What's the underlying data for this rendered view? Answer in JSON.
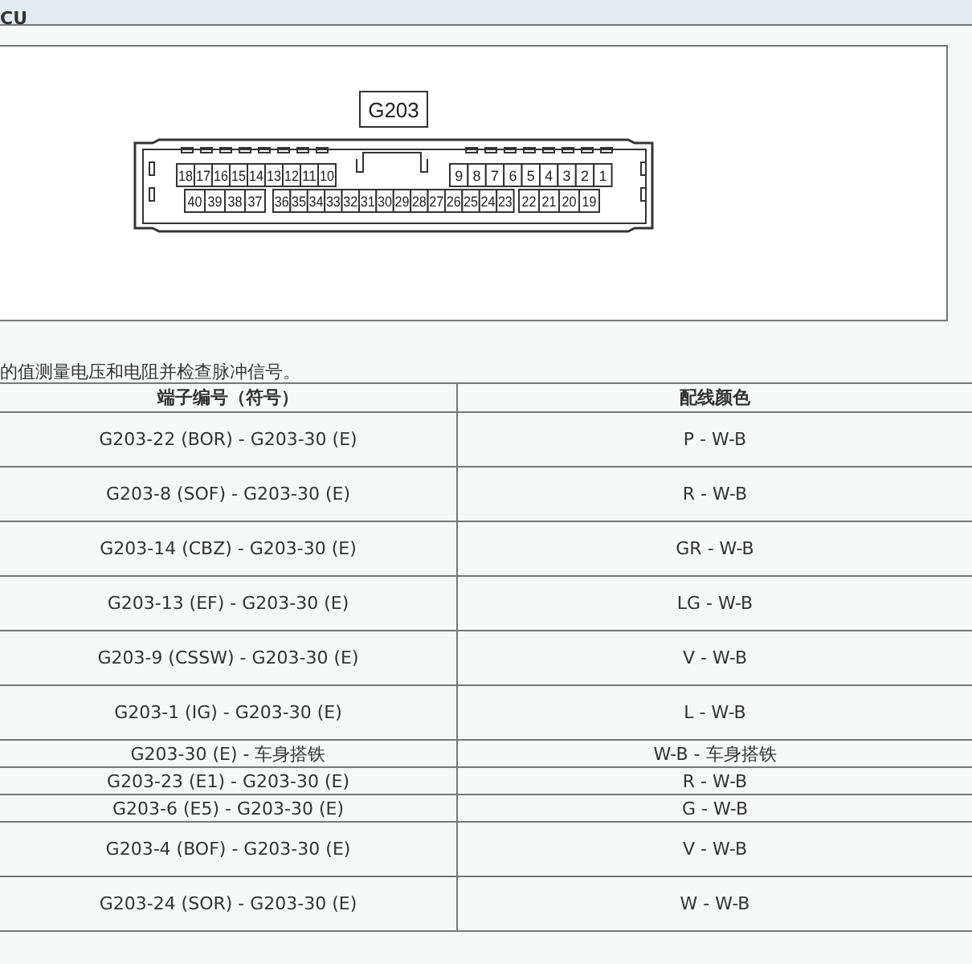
{
  "header": {
    "title": "CU"
  },
  "connector": {
    "label": "G203",
    "top_left_pins": [
      "18",
      "17",
      "16",
      "15",
      "14",
      "13",
      "12",
      "11",
      "10"
    ],
    "top_right_pins": [
      "9",
      "8",
      "7",
      "6",
      "5",
      "4",
      "3",
      "2",
      "1"
    ],
    "bottom_left_pins": [
      "40",
      "39",
      "38",
      "37"
    ],
    "bottom_middle_pins": [
      "36",
      "35",
      "34",
      "33",
      "32",
      "31",
      "30",
      "29",
      "28",
      "27",
      "26",
      "25",
      "24",
      "23"
    ],
    "bottom_right_pins": [
      "22",
      "21",
      "20",
      "19"
    ]
  },
  "instruction": "的值测量电压和电阻并检查脉冲信号。",
  "table": {
    "columns": [
      "端子编号（符号）",
      "配线颜色"
    ],
    "rows": [
      {
        "kind": "tall",
        "terminal": "G203-22 (BOR) - G203-30 (E)",
        "wire_color": "P - W-B"
      },
      {
        "kind": "tall",
        "terminal": "G203-8 (SOF) - G203-30 (E)",
        "wire_color": "R - W-B"
      },
      {
        "kind": "tall",
        "terminal": "G203-14 (CBZ) - G203-30 (E)",
        "wire_color": "GR - W-B"
      },
      {
        "kind": "tall",
        "terminal": "G203-13 (EF) - G203-30 (E)",
        "wire_color": "LG - W-B"
      },
      {
        "kind": "tall",
        "terminal": "G203-9 (CSSW) - G203-30 (E)",
        "wire_color": "V - W-B"
      },
      {
        "kind": "tall",
        "terminal": "G203-1 (IG) - G203-30 (E)",
        "wire_color": "L - W-B"
      },
      {
        "kind": "compact",
        "terminal": "G203-30 (E) - 车身搭铁",
        "wire_color": "W-B - 车身搭铁"
      },
      {
        "kind": "compact",
        "terminal": "G203-23 (E1) - G203-30 (E)",
        "wire_color": "R - W-B"
      },
      {
        "kind": "compact",
        "terminal": "G203-6 (E5) - G203-30 (E)",
        "wire_color": "G - W-B"
      },
      {
        "kind": "tall",
        "terminal": "G203-4 (BOF) - G203-30 (E)",
        "wire_color": "V - W-B"
      },
      {
        "kind": "tall",
        "terminal": "G203-24 (SOR) - G203-30 (E)",
        "wire_color": "W - W-B"
      }
    ]
  }
}
